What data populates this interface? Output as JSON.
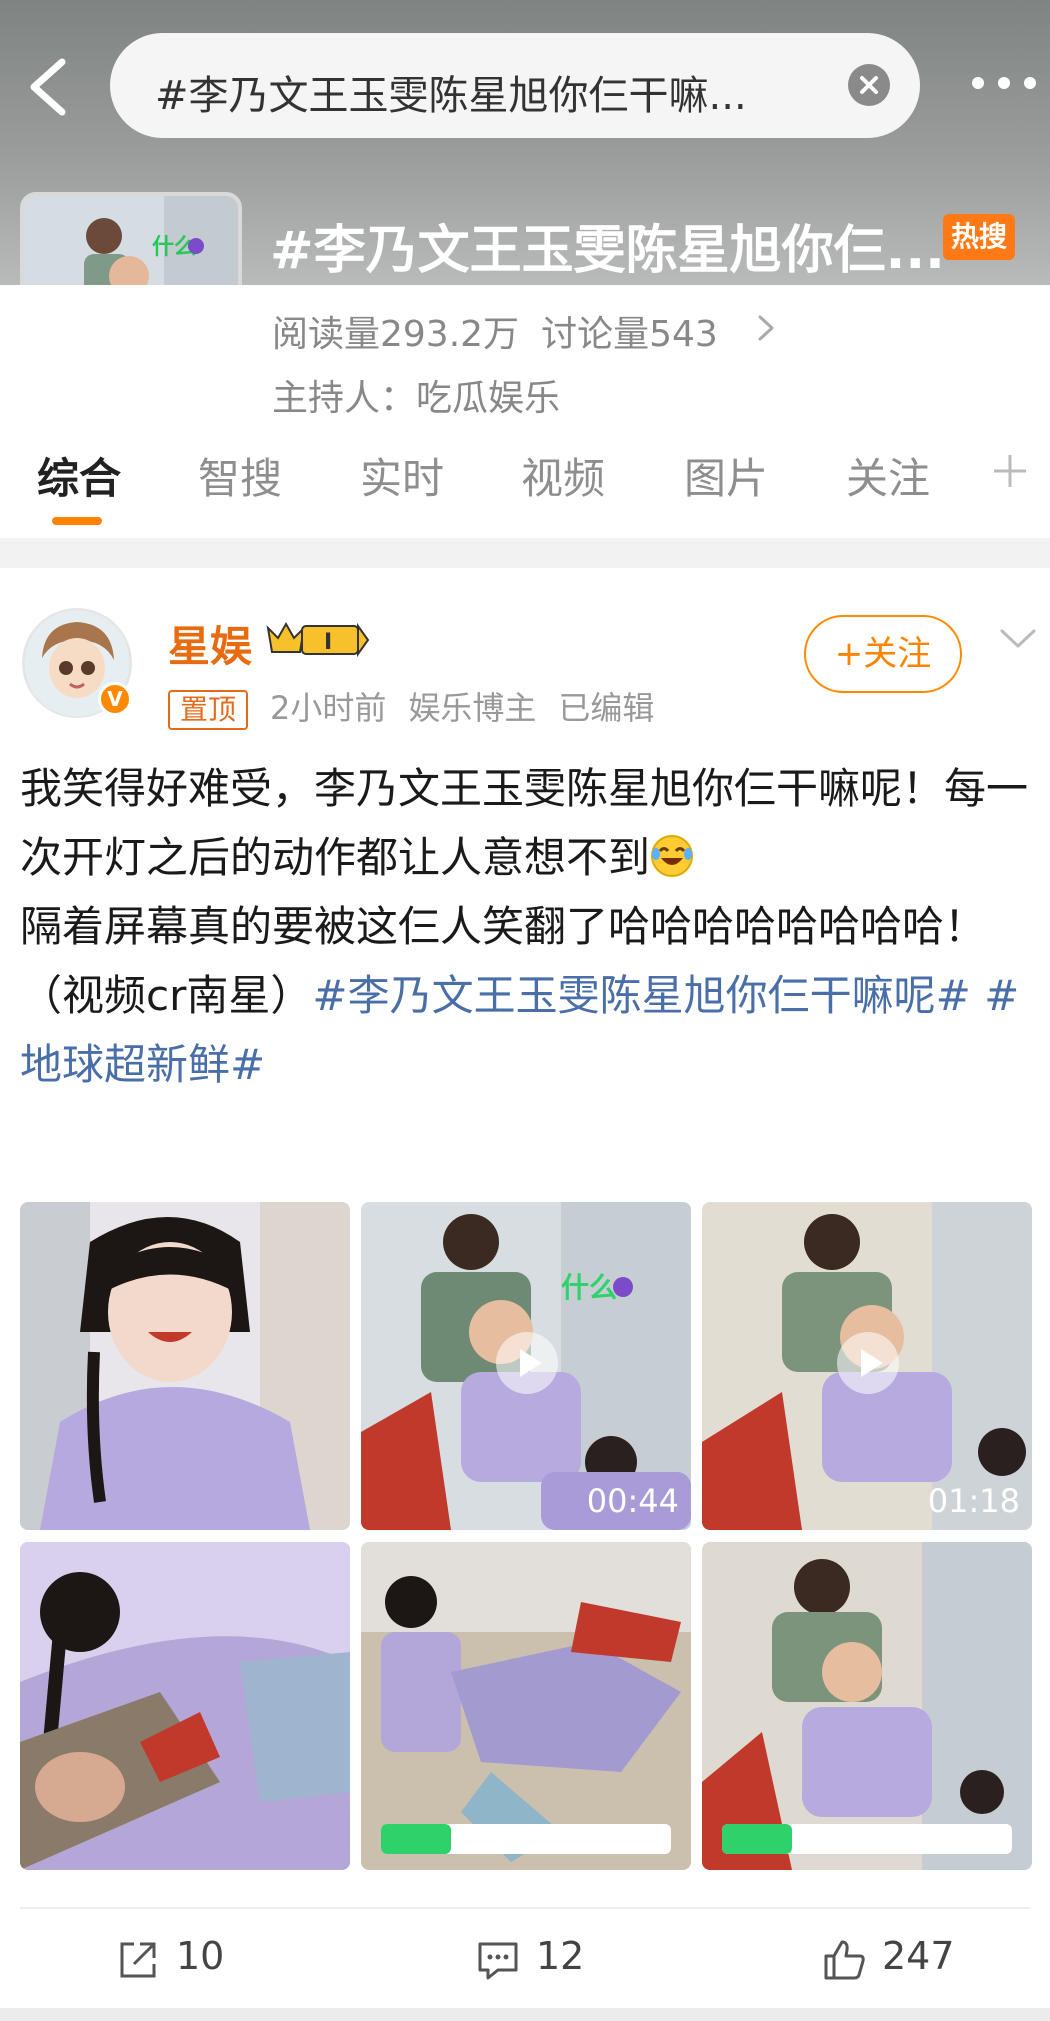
{
  "search": {
    "query": "#李乃文王玉雯陈星旭你仨干嘛..."
  },
  "topic": {
    "title": "#李乃文王玉雯陈星旭你仨...",
    "hot_badge": "热搜",
    "stats": {
      "reads": "阅读量293.2万",
      "discussions": "讨论量543"
    },
    "host": "主持人：吃瓜娱乐"
  },
  "tabs": [
    {
      "label": "综合"
    },
    {
      "label": "智搜"
    },
    {
      "label": "实时"
    },
    {
      "label": "视频"
    },
    {
      "label": "图片"
    },
    {
      "label": "关注"
    }
  ],
  "post": {
    "author": "星娱",
    "pinned_label": "置顶",
    "time": "2小时前",
    "role": "娱乐博主",
    "edited": "已编辑",
    "follow_label": "+关注",
    "text_part1": "我笑得好难受，李乃文王玉雯陈星旭你仨干嘛呢！每一次开灯之后的动作都让人意想不到",
    "text_part2": "隔着屏幕真的要被这仨人笑翻了哈哈哈哈哈哈哈哈！",
    "text_part3": "（视频cr南星）",
    "hashtag1": "#李乃文王玉雯陈星旭你仨干嘛呢#",
    "hashtag2": "#地球超新鲜#",
    "images": [
      {
        "duration": ""
      },
      {
        "duration": "00:44"
      },
      {
        "duration": "01:18"
      },
      {
        "duration": ""
      },
      {
        "duration": ""
      },
      {
        "duration": ""
      }
    ],
    "actions": {
      "reposts": "10",
      "comments": "12",
      "likes": "247"
    }
  },
  "colors": {
    "accent": "#ff8200",
    "hashtag": "#4a6fa8",
    "author": "#e86b10"
  }
}
